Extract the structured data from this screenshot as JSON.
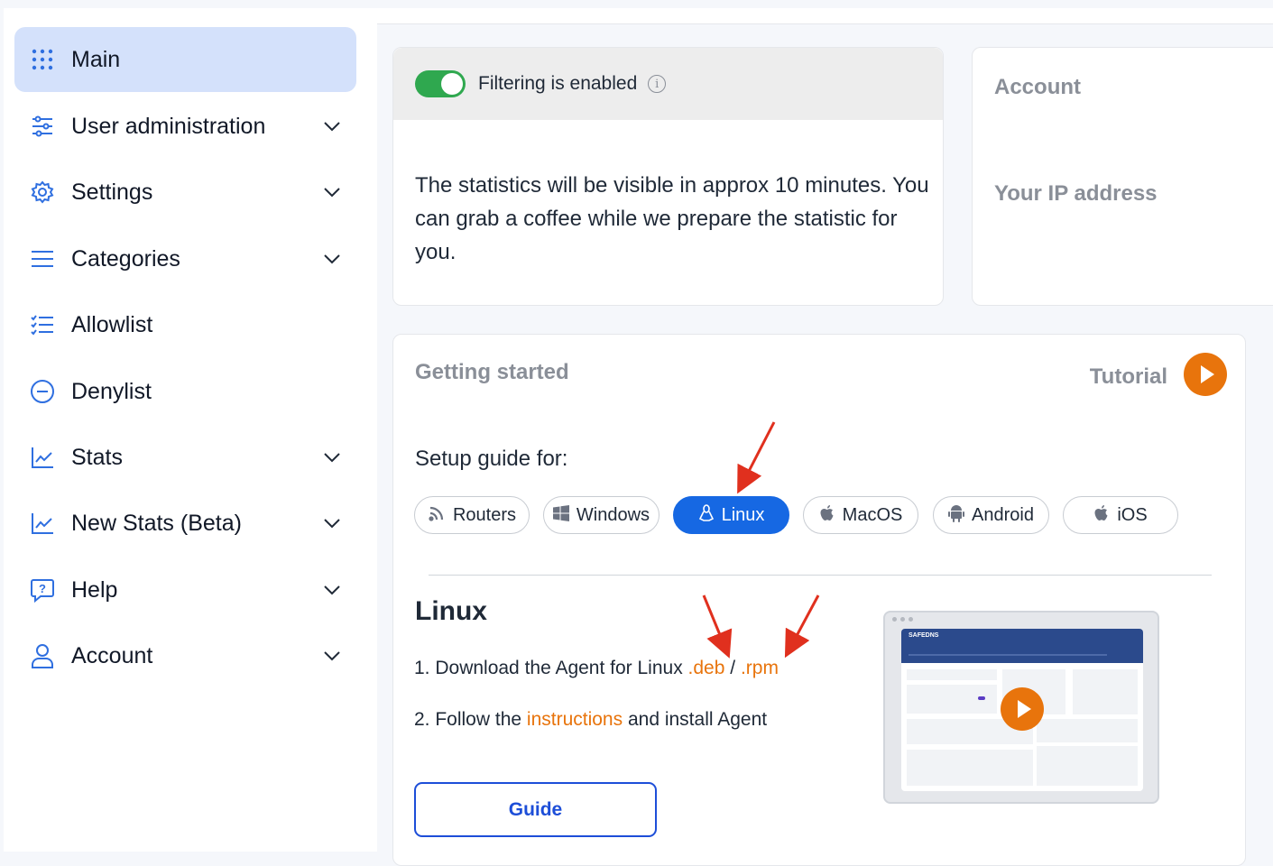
{
  "sidebar": {
    "items": [
      {
        "label": "Main",
        "icon": "grid-icon",
        "active": true,
        "has_chevron": false
      },
      {
        "label": "User administration",
        "icon": "sliders-icon",
        "has_chevron": true
      },
      {
        "label": "Settings",
        "icon": "gear-icon",
        "has_chevron": true
      },
      {
        "label": "Categories",
        "icon": "menu-icon",
        "has_chevron": true
      },
      {
        "label": "Allowlist",
        "icon": "list-check-icon",
        "has_chevron": false
      },
      {
        "label": "Denylist",
        "icon": "minus-circle-icon",
        "has_chevron": false
      },
      {
        "label": "Stats",
        "icon": "chart-line-icon",
        "has_chevron": true
      },
      {
        "label": "New Stats (Beta)",
        "icon": "chart-line-icon",
        "has_chevron": true
      },
      {
        "label": "Help",
        "icon": "help-chat-icon",
        "has_chevron": true
      },
      {
        "label": "Account",
        "icon": "user-icon",
        "has_chevron": true
      }
    ]
  },
  "filter_card": {
    "status_label": "Filtering is enabled",
    "toggle_on": true,
    "message": "The statistics will be visible in approx 10 minutes. You can grab a coffee while we prepare the statistic for you."
  },
  "account_card": {
    "title": "Account",
    "ip_label": "Your IP address"
  },
  "getting_started": {
    "title": "Getting started",
    "tutorial_label": "Tutorial",
    "setup_label": "Setup guide for:",
    "platforms": [
      {
        "label": "Routers",
        "icon": "rss-icon"
      },
      {
        "label": "Windows",
        "icon": "windows-icon"
      },
      {
        "label": "Linux",
        "icon": "linux-icon",
        "active": true
      },
      {
        "label": "MacOS",
        "icon": "apple-icon"
      },
      {
        "label": "Android",
        "icon": "android-icon"
      },
      {
        "label": "iOS",
        "icon": "apple-icon"
      }
    ],
    "section_title": "Linux",
    "step1_prefix": "1. Download the Agent for Linux",
    "step1_deb": ".deb",
    "step1_sep": "/",
    "step1_rpm": ".rpm",
    "step2_prefix": "2. Follow the",
    "step2_link": "instructions",
    "step2_suffix": "and install Agent",
    "guide_button": "Guide",
    "thumbnail_brand": "SAFEDNS"
  },
  "colors": {
    "primary": "#1668e3",
    "accent_orange": "#e8740c",
    "toggle_green": "#2fa84f",
    "active_nav_bg": "#d4e1fb",
    "annotation_red": "#e0301e"
  }
}
